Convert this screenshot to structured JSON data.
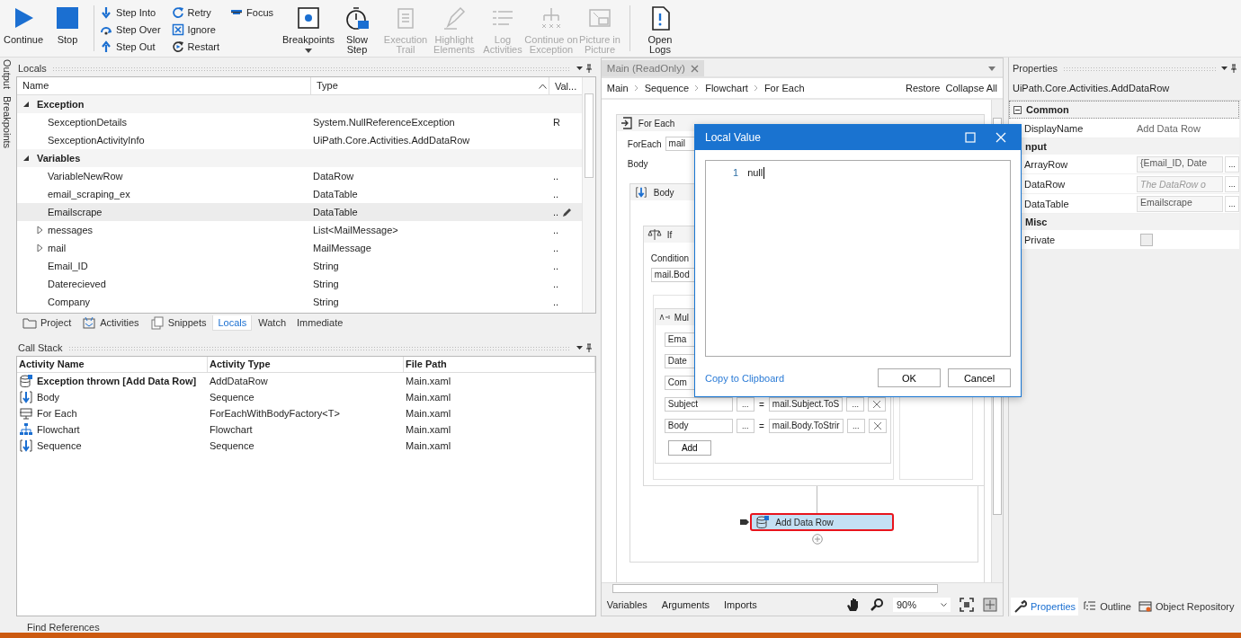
{
  "toolbar": {
    "run": [
      {
        "label": "Continue"
      },
      {
        "label": "Stop"
      }
    ],
    "step_columns": [
      {
        "items": [
          {
            "label": "Step Into"
          },
          {
            "label": "Step Over"
          },
          {
            "label": "Step Out"
          }
        ]
      },
      {
        "items": [
          {
            "label": "Retry"
          },
          {
            "label": "Ignore"
          },
          {
            "label": "Restart"
          }
        ]
      },
      {
        "items": [
          {
            "label": "Focus"
          }
        ]
      }
    ],
    "tools": [
      {
        "label": "Breakpoints",
        "kind": "dropdown",
        "disabled": false
      },
      {
        "label": "Slow\nStep",
        "kind": "button",
        "disabled": false
      },
      {
        "label": "Execution\nTrail",
        "kind": "button",
        "disabled": true
      },
      {
        "label": "Highlight\nElements",
        "kind": "button",
        "disabled": true
      },
      {
        "label": "Log\nActivities",
        "kind": "button",
        "disabled": true
      },
      {
        "label": "Continue on\nException",
        "kind": "button",
        "disabled": true
      },
      {
        "label": "Picture in\nPicture",
        "kind": "button",
        "disabled": true
      }
    ],
    "logs": [
      {
        "label": "Open\nLogs"
      }
    ]
  },
  "side_tabs": [
    "Output",
    "Breakpoints"
  ],
  "locals": {
    "title": "Locals",
    "columns": [
      "Name",
      "Type",
      "Val..."
    ],
    "groups": [
      {
        "name": "Exception",
        "expanded": true,
        "rows": [
          {
            "name": "SexceptionDetails",
            "type": "System.NullReferenceException",
            "value": "R",
            "expandable": false,
            "selected": false
          },
          {
            "name": "SexceptionActivityInfo",
            "type": "UiPath.Core.Activities.AddDataRow",
            "expandable": false,
            "selected": false
          }
        ]
      },
      {
        "name": "Variables",
        "expanded": true,
        "rows": [
          {
            "name": "VariableNewRow",
            "type": "DataRow",
            "value": "..",
            "expandable": false,
            "selected": false
          },
          {
            "name": "email_scraping_ex",
            "type": "DataTable",
            "value": "..",
            "expandable": false,
            "selected": false
          },
          {
            "name": "Emailscrape",
            "type": "DataTable",
            "value": "..",
            "expandable": false,
            "selected": true
          },
          {
            "name": "messages",
            "type": "List<MailMessage>",
            "value": "..",
            "expandable": true,
            "selected": false
          },
          {
            "name": "mail",
            "type": "MailMessage",
            "value": "..",
            "expandable": true,
            "selected": false
          },
          {
            "name": "Email_ID",
            "type": "String",
            "value": "..",
            "expandable": false,
            "selected": false
          },
          {
            "name": "Daterecieved",
            "type": "String",
            "value": "..",
            "expandable": false,
            "selected": false
          },
          {
            "name": "Company",
            "type": "String",
            "value": "..",
            "expandable": false,
            "selected": false
          }
        ]
      }
    ]
  },
  "left_tabs": [
    {
      "label": "Project",
      "selected": false
    },
    {
      "label": "Activities",
      "selected": false
    },
    {
      "label": "Snippets",
      "selected": false
    },
    {
      "label": "Locals",
      "selected": true
    },
    {
      "label": "Watch",
      "selected": false
    },
    {
      "label": "Immediate",
      "selected": false
    }
  ],
  "call_stack": {
    "title": "Call Stack",
    "columns": [
      "Activity Name",
      "Activity Type",
      "File Path"
    ],
    "rows": [
      {
        "name": "Exception thrown [Add Data Row]",
        "type": "AddDataRow",
        "path": "Main.xaml",
        "current": true
      },
      {
        "name": "Body",
        "type": "Sequence",
        "path": "Main.xaml",
        "current": false
      },
      {
        "name": "For Each",
        "type": "ForEachWithBodyFactory<T>",
        "path": "Main.xaml",
        "current": false
      },
      {
        "name": "Flowchart",
        "type": "Flowchart",
        "path": "Main.xaml",
        "current": false
      },
      {
        "name": "Sequence",
        "type": "Sequence",
        "path": "Main.xaml",
        "current": false
      }
    ]
  },
  "find_references": "Find References",
  "designer": {
    "tab": "Main (ReadOnly)",
    "breadcrumb": [
      "Main",
      "Sequence",
      "Flowchart",
      "For Each"
    ],
    "actions": [
      "Restore",
      "Collapse All"
    ],
    "for_each": {
      "title": "For Each",
      "field_label": "ForEach",
      "field_value": "mail",
      "body_label": "Body"
    },
    "body": {
      "title": "Body"
    },
    "if": {
      "title": "If",
      "condition_label": "Condition",
      "condition": "mail.Bod"
    },
    "assign": {
      "title": "Mul",
      "rows": [
        {
          "target": "Ema"
        },
        {
          "target": "Date"
        },
        {
          "target": "Com"
        },
        {
          "target": "Subject",
          "target_browse": "...",
          "operator": "=",
          "value": "mail.Subject.ToS",
          "value_browse": "..."
        },
        {
          "target": "Body",
          "target_browse": "...",
          "operator": "=",
          "value": "mail.Body.ToStrir",
          "value_browse": "..."
        }
      ],
      "add": "Add"
    },
    "faulted": {
      "title": "Add Data Row",
      "error": true
    },
    "bottom_tabs": [
      "Variables",
      "Arguments",
      "Imports"
    ],
    "zoom": "90%"
  },
  "dialog": {
    "title": "Local Value",
    "line": "1",
    "code": "null",
    "link": "Copy to Clipboard",
    "buttons": [
      "OK",
      "Cancel"
    ]
  },
  "properties": {
    "title": "Properties",
    "object": "UiPath.Core.Activities.AddDataRow",
    "categories": [
      {
        "name": "Common",
        "expanded": true,
        "rows": [
          {
            "name": "DisplayName",
            "kind": "text",
            "value": "Add Data Row"
          }
        ]
      },
      {
        "name": "nput",
        "rows": [
          {
            "name": "ArrayRow",
            "kind": "field",
            "value": "{Email_ID, Date",
            "browse": "..."
          },
          {
            "name": "DataRow",
            "kind": "field",
            "placeholder": "The DataRow o",
            "browse": "..."
          },
          {
            "name": "DataTable",
            "kind": "field",
            "value": "Emailscrape",
            "browse": "..."
          }
        ]
      },
      {
        "name": "Misc",
        "rows": [
          {
            "name": "Private",
            "kind": "checkbox",
            "checked": false
          }
        ]
      }
    ],
    "tabs": [
      {
        "label": "Properties",
        "selected": true
      },
      {
        "label": "Outline",
        "selected": false
      },
      {
        "label": "Object Repository",
        "selected": false
      }
    ]
  }
}
